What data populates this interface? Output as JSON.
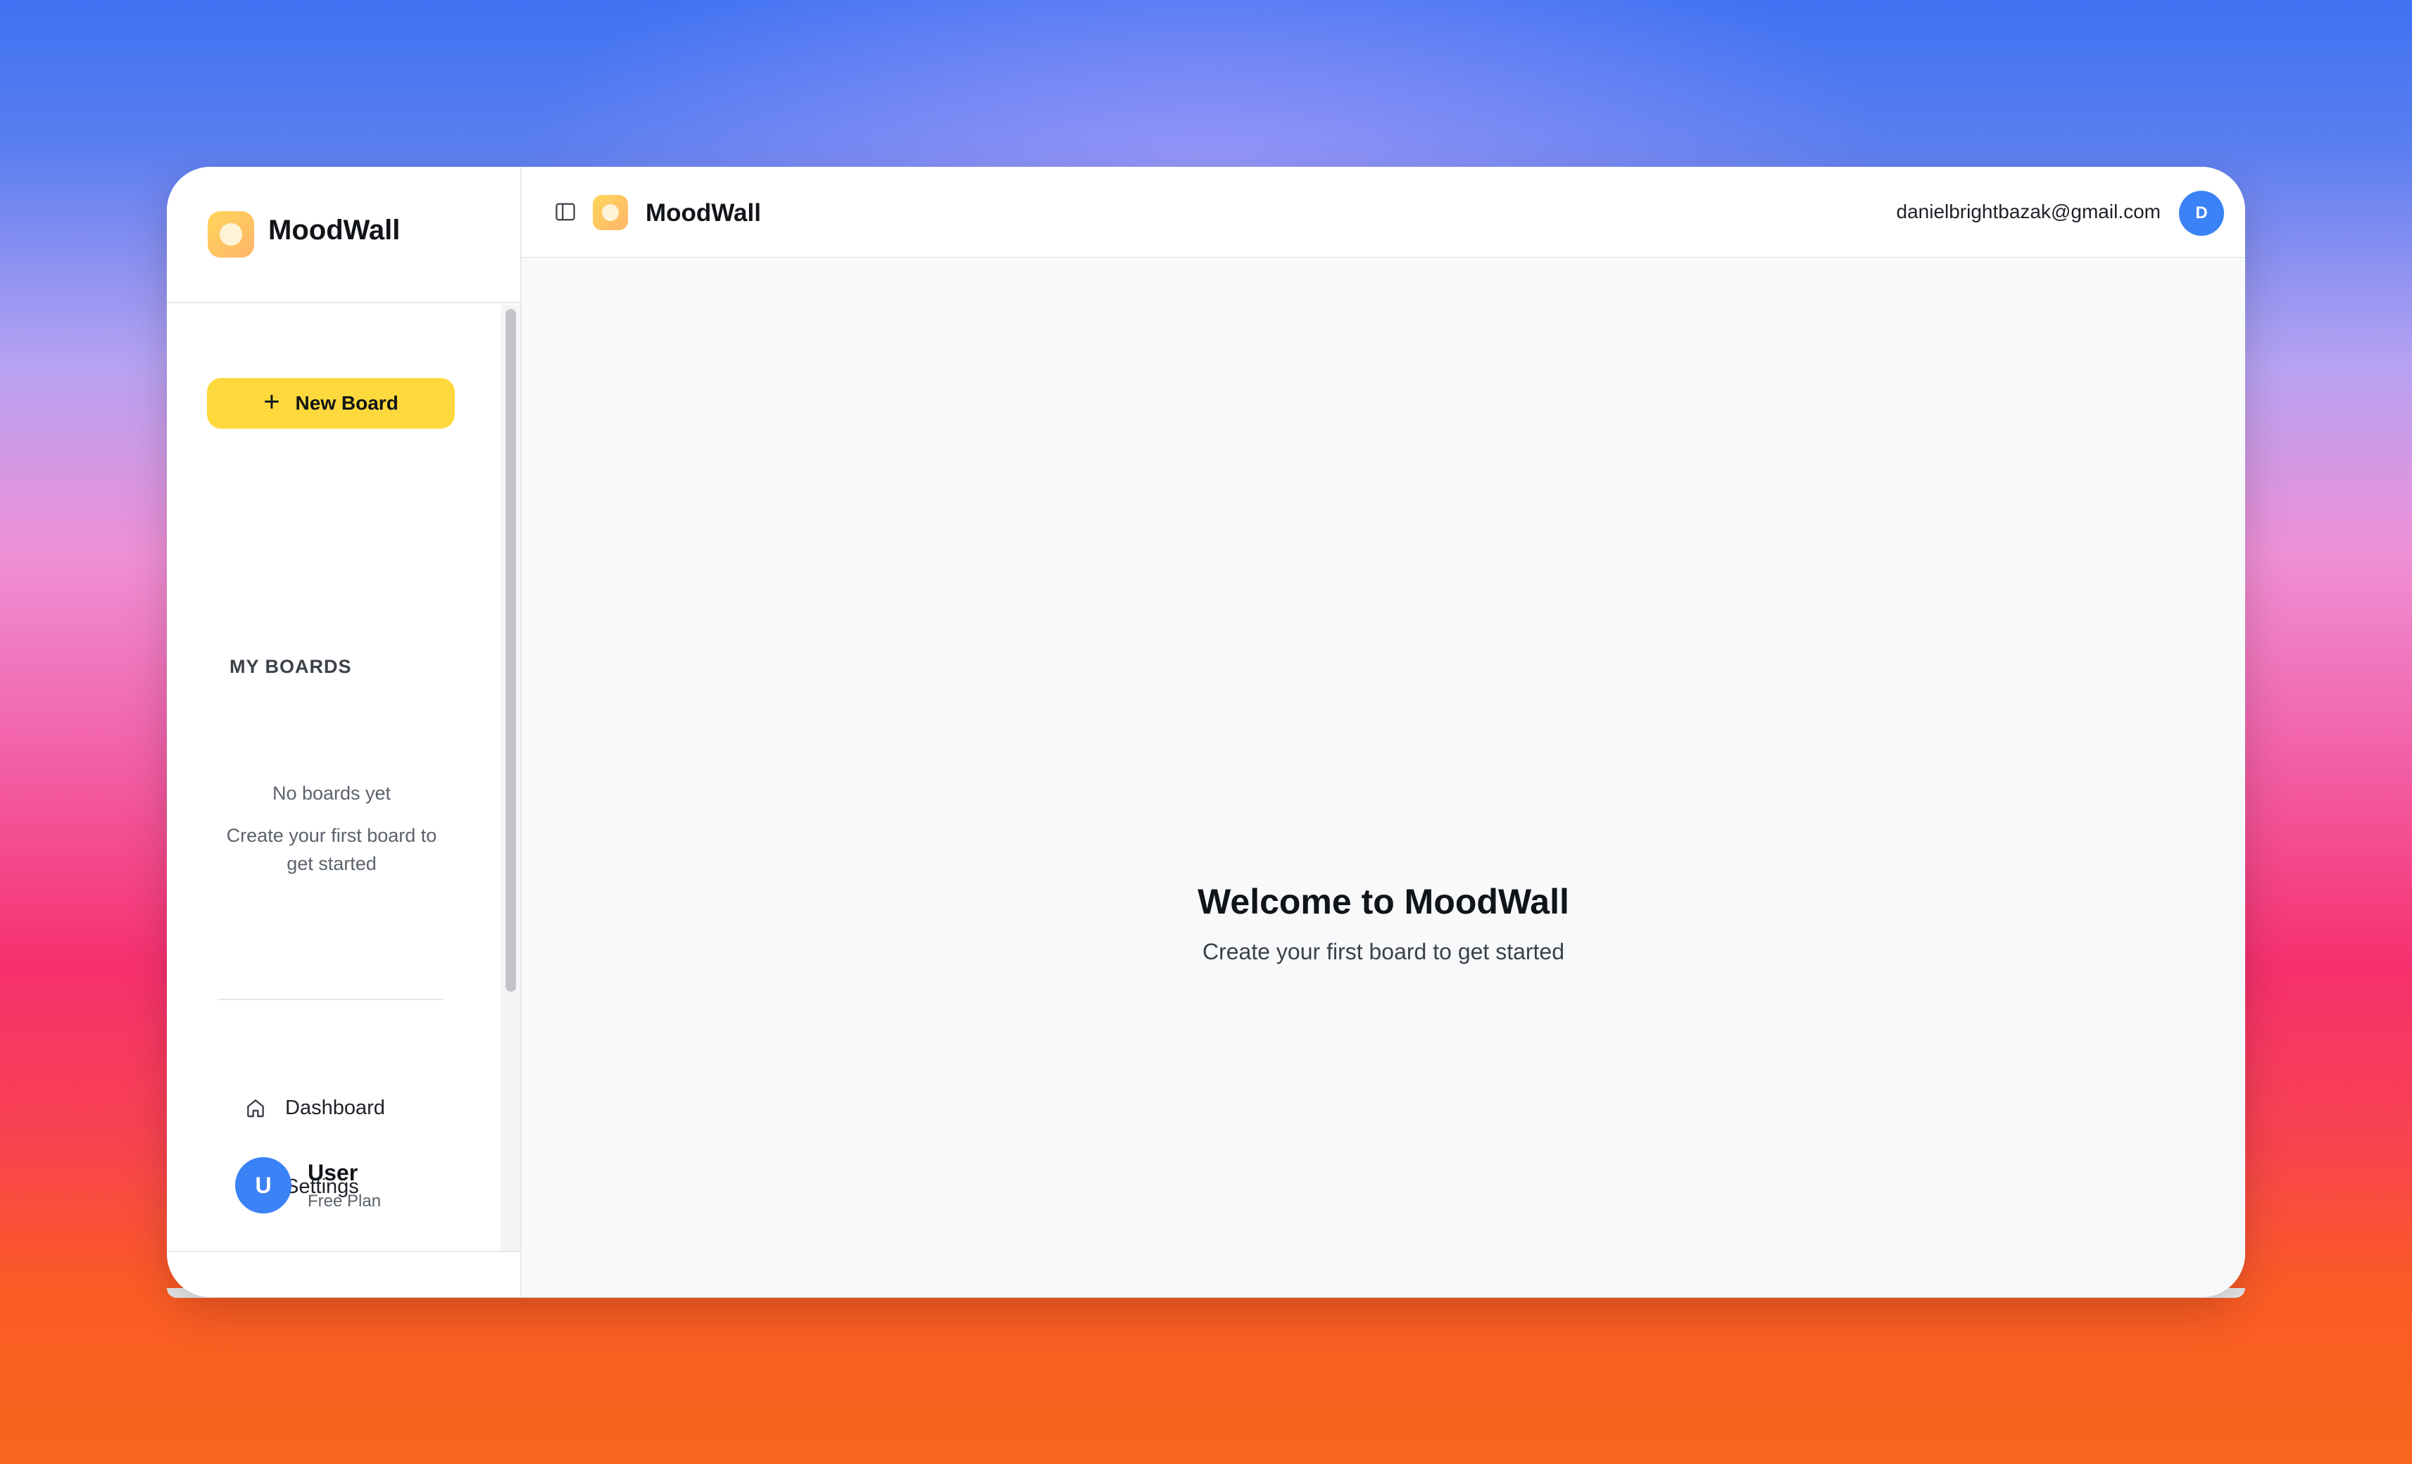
{
  "app": {
    "name": "MoodWall"
  },
  "sidebar": {
    "new_board_label": "New Board",
    "section_label": "MY BOARDS",
    "empty_title": "No boards yet",
    "empty_subtitle": "Create your first board to get started",
    "nav": [
      {
        "label": "Dashboard",
        "icon": "home-icon"
      },
      {
        "label": "Settings",
        "icon": "gear-icon"
      }
    ],
    "user": {
      "avatar_initial": "U",
      "name": "User",
      "plan": "Free Plan"
    }
  },
  "topbar": {
    "title": "MoodWall",
    "email": "danielbrightbazak@gmail.com",
    "avatar_initial": "D"
  },
  "main": {
    "welcome_title": "Welcome to MoodWall",
    "welcome_subtitle": "Create your first board to get started"
  },
  "colors": {
    "accent_yellow": "#fdd93d",
    "avatar_blue": "#3b82f6"
  }
}
